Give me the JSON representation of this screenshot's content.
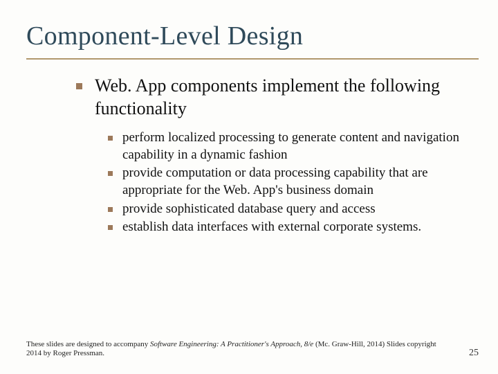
{
  "title": "Component-Level Design",
  "lead": "Web. App components implement the following functionality",
  "subpoints": [
    "perform localized processing to generate content and navigation capability in a dynamic fashion",
    " provide computation or data processing capability that are appropriate for the Web. App's business domain",
    " provide sophisticated database query and access",
    " establish data interfaces with external corporate systems."
  ],
  "footer": {
    "prefix": "These slides are designed to accompany ",
    "book": "Software Engineering: A Practitioner's Approach, 8/e",
    "suffix": " (Mc. Graw-Hill, 2014) Slides copyright 2014 by Roger Pressman."
  },
  "page": "25"
}
